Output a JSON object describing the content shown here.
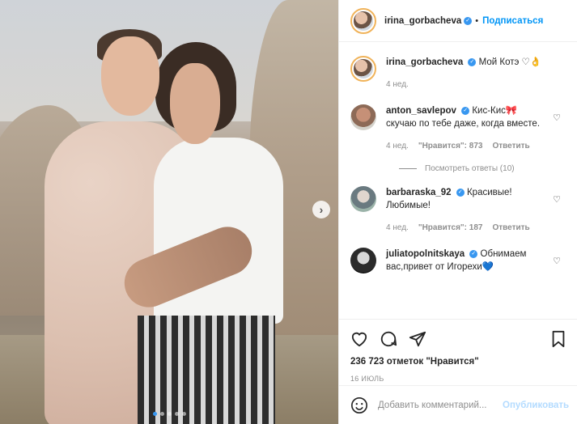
{
  "post": {
    "author": "irina_gorbacheva",
    "follow_label": "Подписаться",
    "more_label": "•••",
    "caption_text": "Мой Котэ",
    "caption_emoji": "♡👌",
    "caption_time": "4 нед.",
    "carousel": {
      "dots": 5,
      "active_index": 0
    }
  },
  "comments": [
    {
      "username": "anton_savlepov",
      "verified": true,
      "text": "Кис-Кис🎀 скучаю по тебе даже, когда вместе.",
      "time": "4 нед.",
      "likes": "\"Нравится\": 873",
      "reply": "Ответить",
      "view_replies": "Посмотреть ответы (10)"
    },
    {
      "username": "barbaraska_92",
      "verified": true,
      "text": "Красивые! Любимые!",
      "time": "4 нед.",
      "likes": "\"Нравится\": 187",
      "reply": "Ответить"
    },
    {
      "username": "juliatopolnitskaya",
      "verified": true,
      "text": "Обнимаем вас,привет от Игорехи💙"
    }
  ],
  "stats": {
    "likes": "236 723 отметок \"Нравится\"",
    "date": "16 июль"
  },
  "add_comment": {
    "placeholder": "Добавить комментарий...",
    "publish_label": "Опубликовать"
  },
  "colors": {
    "accent": "#0095f6",
    "verified": "#3897f0",
    "muted": "#8e8e8e"
  }
}
